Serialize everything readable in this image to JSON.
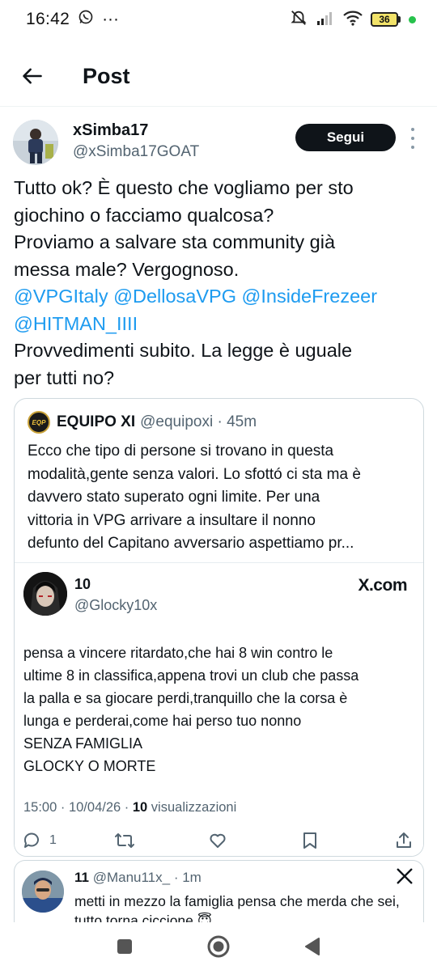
{
  "status_bar": {
    "time": "16:42",
    "dots": "···",
    "battery": "36"
  },
  "header": {
    "title": "Post"
  },
  "author": {
    "name": "xSimba17",
    "handle": "@xSimba17GOAT",
    "follow_label": "Segui"
  },
  "tweet": {
    "line1": "Tutto ok? È questo che vogliamo per sto",
    "line2": "giochino o facciamo qualcosa?",
    "line3": "Proviamo a salvare sta community già",
    "line4": "messa male? Vergognoso.",
    "mentions_line1": [
      "@VPGItaly",
      "@DellosaVPG",
      "@InsideFrezeer"
    ],
    "mention_line2": "@HITMAN_IIII",
    "line7": "Provvedimenti subito. La legge è uguale",
    "line8": "per tutti no?"
  },
  "quote": {
    "logo_text": "EQP",
    "name": "EQUIPO XI",
    "handle_time": "@equipoxi · 45m",
    "lines": [
      "Ecco che tipo di persone si trovano in questa",
      "modalità,gente senza valori. Lo sfottó ci sta ma è",
      "davvero stato superato ogni limite. Per una",
      "vittoria in VPG arrivare a insultare il nonno",
      "defunto del Capitano avversario aspettiamo pr..."
    ],
    "media": {
      "name": "10",
      "handle": "@Glocky10x",
      "brand": "X.com",
      "lines": [
        "pensa a vincere ritardato,che hai 8 win contro le",
        "ultime 8 in classifica,appena trovi un club che passa",
        "la palla e sa giocare perdi,tranquillo che la corsa è",
        "lunga e perderai,come hai perso tuo nonno",
        "SENZA FAMIGLIA",
        "GLOCKY O MORTE"
      ],
      "meta_time": "15:00 · 10/04/26 · ",
      "meta_views": "10",
      "meta_views_label": " visualizzazioni"
    }
  },
  "actions": {
    "reply_count": "1"
  },
  "reply": {
    "name": "11",
    "handle_time": " @Manu11x_ · 1m",
    "line1": "metti in mezzo la famiglia pensa che merda che sei,",
    "line2": "tutto torna ciccione 😇"
  }
}
